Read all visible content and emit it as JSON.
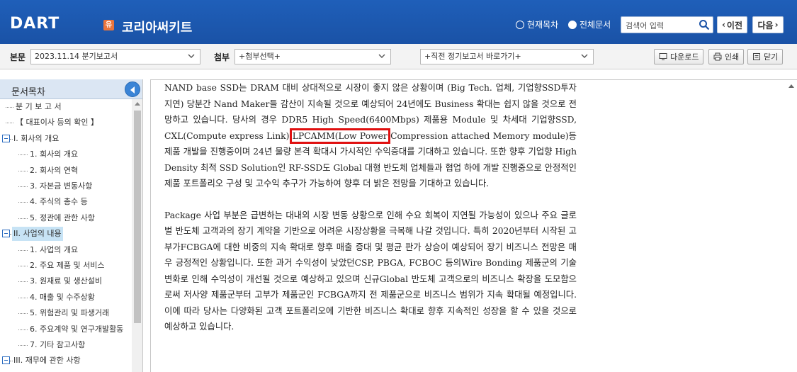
{
  "header": {
    "logo_text": "DART",
    "company_badge": "유",
    "company_name": "코리아써키트",
    "radio_current": "현재목차",
    "radio_all": "전체문서",
    "search_placeholder": "검색어 입력",
    "prev_label": "이전",
    "next_label": "다음"
  },
  "toolbar": {
    "main_label": "본문",
    "main_select": "2023.11.14  분기보고서",
    "attach_label": "첨부",
    "attach_select": "+첨부선택+",
    "recent_select": "+직전 정기보고서 바로가기+",
    "download_label": "다운로드",
    "print_label": "인쇄",
    "close_label": "닫기"
  },
  "sidebar": {
    "title": "문서목차",
    "items": [
      {
        "label": "분 기 보 고 서",
        "level": 1
      },
      {
        "label": "【 대표이사 등의 확인 】",
        "level": 1
      },
      {
        "label": "I. 회사의 개요",
        "level": 0
      },
      {
        "label": "1. 회사의 개요",
        "level": 2
      },
      {
        "label": "2. 회사의 연혁",
        "level": 2
      },
      {
        "label": "3. 자본금 변동사항",
        "level": 2
      },
      {
        "label": "4. 주식의 총수 등",
        "level": 2
      },
      {
        "label": "5. 정관에 관한 사항",
        "level": 2
      },
      {
        "label": "II. 사업의 내용",
        "level": 0
      },
      {
        "label": "1. 사업의 개요",
        "level": 2
      },
      {
        "label": "2. 주요 제품 및 서비스",
        "level": 2
      },
      {
        "label": "3. 원재료 및 생산설비",
        "level": 2
      },
      {
        "label": "4. 매출 및 수주상황",
        "level": 2
      },
      {
        "label": "5. 위험관리 및 파생거래",
        "level": 2
      },
      {
        "label": "6. 주요계약 및 연구개발활동",
        "level": 2
      },
      {
        "label": "7. 기타 참고사항",
        "level": 2
      },
      {
        "label": "III. 재무에 관한 사항",
        "level": 0
      }
    ]
  },
  "content": {
    "p1_before": "NAND base SSD는 DRAM 대비 상대적으로 시장이 좋지 않은 상황이며 (Big Tech. 업체, 기업향SSD투자 지연) 당분간 Nand Maker들 감산이 지속될 것으로 예상되어 24년에도 Business 확대는 쉽지 않을 것으로 전망하고 있습니다. 당사의 경우 DDR5 High Speed(6400Mbps) 제품용 Module 및 차세대 기업향SSD, CXL(Compute express Link) ",
    "p1_highlight": "LPCAMM(Low Power",
    "p1_after": " Compression attached Memory module)등 제품 개발을 진행중이며 24년 물량 본격 확대시 가시적인 수익증대를 기대하고 있습니다. 또한 향후 기업향 High Density 최적 SSD Solution인 RF-SSD도 Global 대형 반도체 업체들과 협업 하에 개발 진행중으로 안정적인 제품 포트폴리오 구성 및 고수익 추구가 가능하여 향후 더 밝은 전망을 기대하고 있습니다.",
    "p2": "Package 사업 부분은 급변하는 대내외 시장 변동 상황으로 인해 수요 회복이 지연될 가능성이 있으나 주요 글로벌 반도체 고객과의 장기 계약을 기반으로 어려운 시장상황을 극복해 나갈 것입니다. 특히 2020년부터 시작된 고부가FCBGA에 대한 비중의 지속 확대로 향후 매출 증대 및 평균 판가 상승이 예상되어 장기 비즈니스 전망은 매우 긍정적인 상황입니다.  또한 과거 수익성이 낮았던CSP, PBGA, FCBOC 등의Wire Bonding 제품군의 기술 변화로 인해 수익성이 개선될 것으로 예상하고 있으며 신규Global 반도체 고객으로의 비즈니스 확장을 도모함으로써 저사양 제품군부터 고부가 제품군인 FCBGA까지 전 제품군으로 비즈니스 범위가 지속 확대될 예정입니다. 이에 따라 당사는 다양화된 고객 포트폴리오에 기반한 비즈니스 확대로 향후 지속적인 성장을 할 수 있을 것으로 예상하고 있습니다."
  },
  "colors": {
    "header_blue": "#1a52a6",
    "highlight_red": "#e01010",
    "selected_item": "#c7e3f5"
  }
}
